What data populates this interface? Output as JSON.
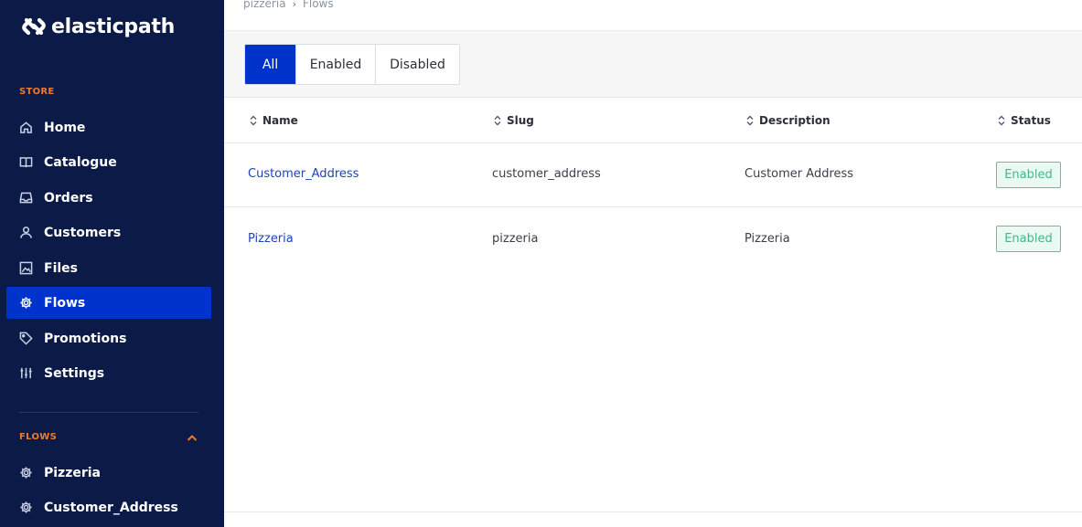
{
  "brand": {
    "name": "elasticpath",
    "logo_icon": "elasticpath-logo-icon"
  },
  "sidebar": {
    "store_label": "STORE",
    "items": [
      {
        "label": "Home",
        "icon": "home-icon"
      },
      {
        "label": "Catalogue",
        "icon": "book-icon"
      },
      {
        "label": "Orders",
        "icon": "inbox-icon"
      },
      {
        "label": "Customers",
        "icon": "user-icon"
      },
      {
        "label": "Files",
        "icon": "image-icon"
      },
      {
        "label": "Flows",
        "icon": "gear-icon",
        "active": true
      },
      {
        "label": "Promotions",
        "icon": "tag-icon"
      },
      {
        "label": "Settings",
        "icon": "sliders-icon"
      }
    ],
    "flows_label": "FLOWS",
    "flows_items": [
      {
        "label": "Pizzeria",
        "icon": "gear-icon"
      },
      {
        "label": "Customer_Address",
        "icon": "gear-icon"
      }
    ]
  },
  "breadcrumb": {
    "parent": "pizzeria",
    "separator": "›",
    "current": "Flows"
  },
  "filters": {
    "all": "All",
    "enabled": "Enabled",
    "disabled": "Disabled",
    "selected": "All"
  },
  "table": {
    "columns": [
      "Name",
      "Slug",
      "Description",
      "Status"
    ],
    "rows": [
      {
        "name": "Customer_Address",
        "slug": "customer_address",
        "description": "Customer Address",
        "status": "Enabled"
      },
      {
        "name": "Pizzeria",
        "slug": "pizzeria",
        "description": "Pizzeria",
        "status": "Enabled"
      }
    ]
  },
  "colors": {
    "sidebar_bg": "#0b1a47",
    "accent": "#0033cc",
    "section_label": "#f07a2c",
    "badge_green": "#47b386"
  }
}
